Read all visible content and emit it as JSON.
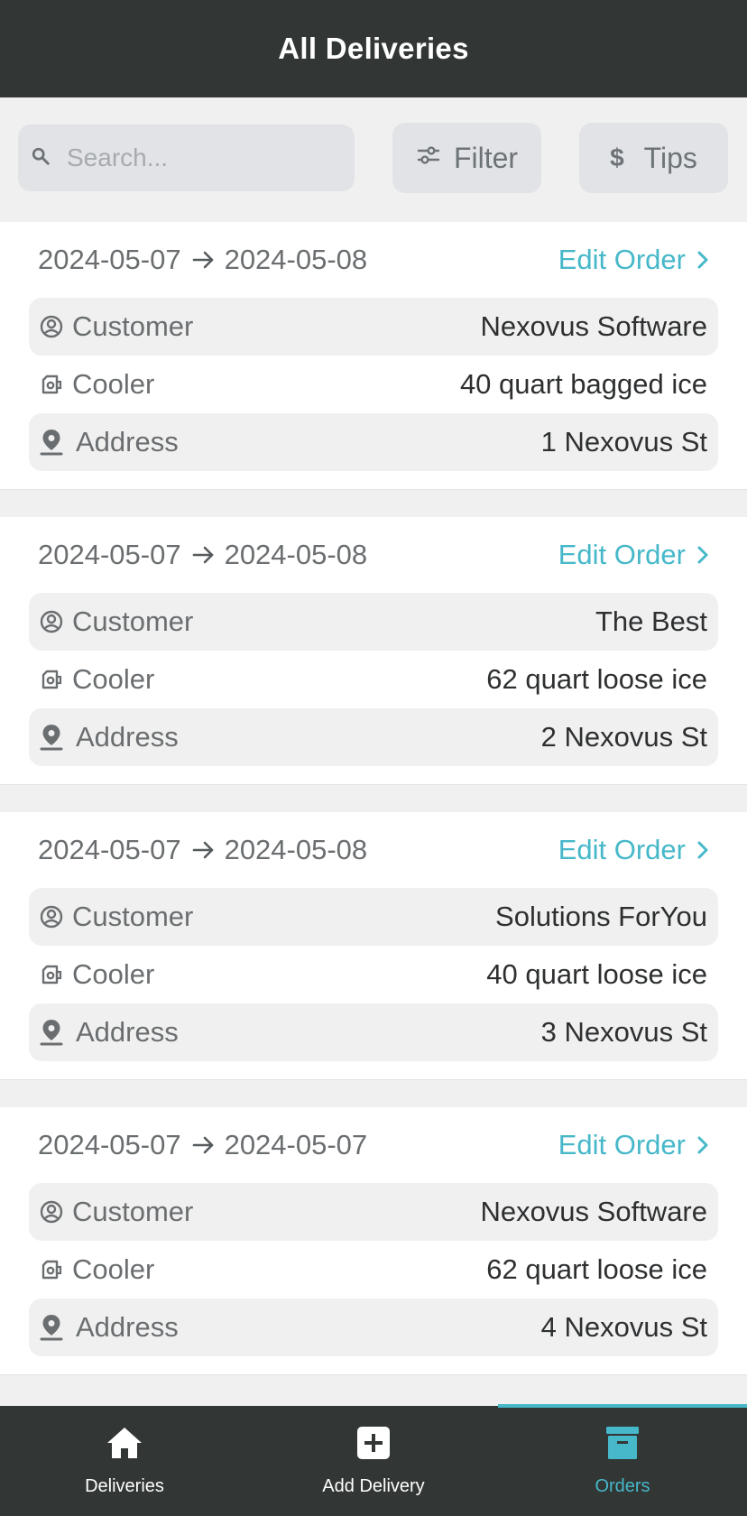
{
  "header": {
    "title": "All Deliveries"
  },
  "toolbar": {
    "search_placeholder": "Search...",
    "filter_label": "Filter",
    "tips_label": "Tips"
  },
  "labels": {
    "customer": "Customer",
    "cooler": "Cooler",
    "address": "Address",
    "edit_order": "Edit Order"
  },
  "deliveries": [
    {
      "start": "2024-05-07",
      "end": "2024-05-08",
      "customer": "Nexovus Software",
      "cooler": "40 quart bagged ice",
      "address": "1 Nexovus St"
    },
    {
      "start": "2024-05-07",
      "end": "2024-05-08",
      "customer": "The Best",
      "cooler": "62 quart loose ice",
      "address": "2 Nexovus St"
    },
    {
      "start": "2024-05-07",
      "end": "2024-05-08",
      "customer": "Solutions ForYou",
      "cooler": "40 quart loose ice",
      "address": "3 Nexovus St"
    },
    {
      "start": "2024-05-07",
      "end": "2024-05-07",
      "customer": "Nexovus Software",
      "cooler": "62 quart loose ice",
      "address": "4 Nexovus St"
    }
  ],
  "tabs": [
    {
      "label": "Deliveries",
      "icon": "home-icon"
    },
    {
      "label": "Add Delivery",
      "icon": "plus-square-icon"
    },
    {
      "label": "Orders",
      "icon": "archive-icon",
      "active": true
    }
  ],
  "colors": {
    "accent": "#46b8c9",
    "header_bg": "#323635",
    "page_bg": "#f0f0f0"
  }
}
